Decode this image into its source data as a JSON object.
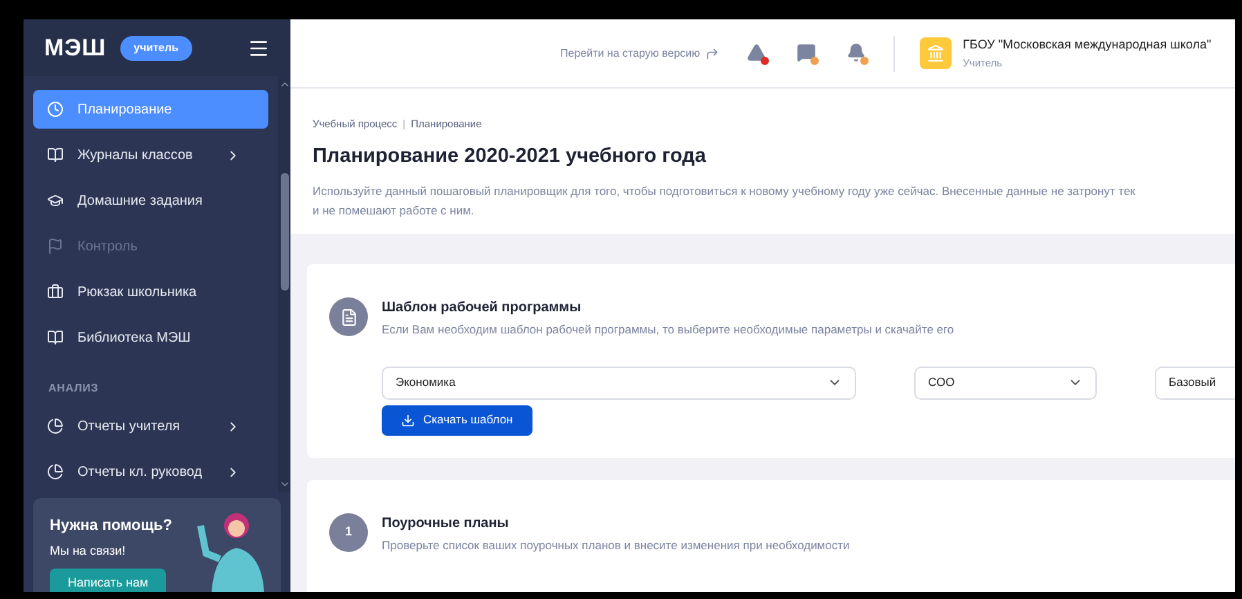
{
  "sidebar": {
    "logo": "МЭШ",
    "role_badge": "учитель",
    "items": [
      {
        "label": "Планирование",
        "selected": true,
        "disabled": false,
        "has_submenu": false
      },
      {
        "label": "Журналы классов",
        "selected": false,
        "disabled": false,
        "has_submenu": true
      },
      {
        "label": "Домашние задания",
        "selected": false,
        "disabled": false,
        "has_submenu": false
      },
      {
        "label": "Контроль",
        "selected": false,
        "disabled": true,
        "has_submenu": false
      },
      {
        "label": "Рюкзак школьника",
        "selected": false,
        "disabled": false,
        "has_submenu": false
      },
      {
        "label": "Библиотека МЭШ",
        "selected": false,
        "disabled": false,
        "has_submenu": false
      }
    ],
    "section": "АНАЛИЗ",
    "section_items": [
      {
        "label": "Отчеты учителя",
        "selected": false,
        "disabled": false,
        "has_submenu": true
      },
      {
        "label": "Отчеты кл. руковод",
        "selected": false,
        "disabled": false,
        "has_submenu": true
      }
    ],
    "help": {
      "title": "Нужна помощь?",
      "subtitle": "Мы на связи!",
      "button": "Написать нам"
    }
  },
  "header": {
    "old_version_link": "Перейти на старую версию",
    "notifications": [
      {
        "color": "#e02a2a"
      },
      {
        "color": "#f0a050"
      },
      {
        "color": "#f0a050"
      }
    ],
    "school": "ГБОУ \"Московская международная школа\"",
    "user_role": "Учитель"
  },
  "breadcrumbs": [
    {
      "label": "Учебный процесс"
    },
    {
      "label": "Планирование"
    }
  ],
  "breadcrumb_separator": "|",
  "title": "Планирование 2020-2021 учебного года",
  "description": [
    "Используйте данный пошаговый планировщик для того, чтобы подготовиться к новому учебному году уже сейчас. Внесенные данные не затронут тек",
    "и не помешают работе с ним."
  ],
  "template_card": {
    "title": "Шаблон рабочей программы",
    "subtitle": "Если Вам необходим шаблон рабочей программы, то выберите необходимые параметры и скачайте его",
    "selects": [
      {
        "value": "Экономика"
      },
      {
        "value": "СОО"
      },
      {
        "value": "Базовый"
      }
    ],
    "button": "Скачать шаблон"
  },
  "steps": [
    {
      "number": "1",
      "title": "Поурочные планы",
      "subtitle": "Проверьте список ваших поурочных планов и внесите изменения при необходимости"
    }
  ]
}
